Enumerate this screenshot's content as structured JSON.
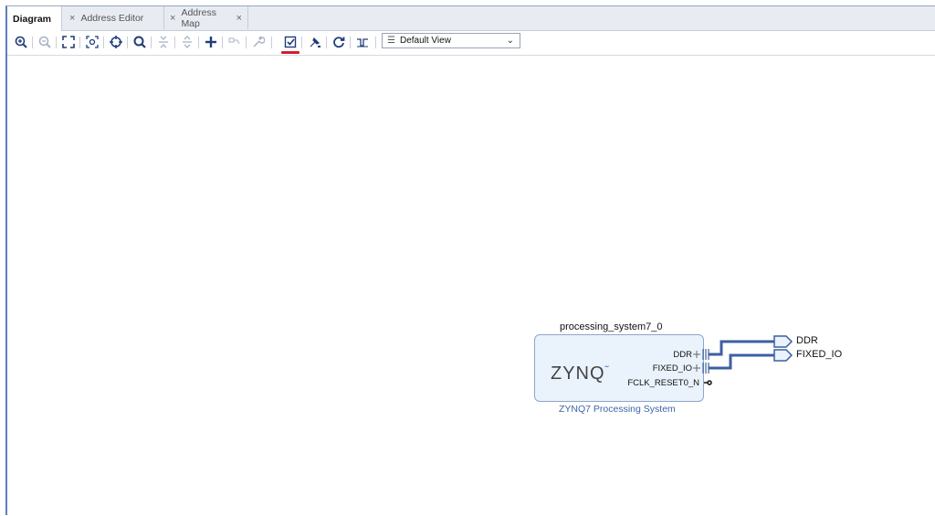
{
  "tabs": [
    {
      "label": "Diagram",
      "active": true
    },
    {
      "label": "Address Editor",
      "active": false
    },
    {
      "label": "Address Map",
      "active": false
    }
  ],
  "tab_close_glyph": "×",
  "toolbar": {
    "icons": [
      "zoom-in-icon",
      "zoom-out-icon",
      "fit-view-icon",
      "fit-selection-icon",
      "regenerate-layout-icon",
      "search-icon",
      "collapse-all-icon",
      "expand-all-icon",
      "add-ip-icon",
      "make-connection-icon",
      "customize-block-icon",
      "validate-design-icon",
      "run-connection-automation-icon",
      "refresh-icon",
      "optimize-routing-icon"
    ],
    "view_select": "Default View",
    "accent": "#d0202a"
  },
  "diagram": {
    "ip_instance": "processing_system7_0",
    "ip_logo": "ZYNQ",
    "ip_subtitle": "ZYNQ7 Processing System",
    "ports": [
      "DDR",
      "FIXED_IO",
      "FCLK_RESET0_N"
    ],
    "external_ports": [
      "DDR",
      "FIXED_IO"
    ],
    "wire_color": "#3d5fa0"
  }
}
